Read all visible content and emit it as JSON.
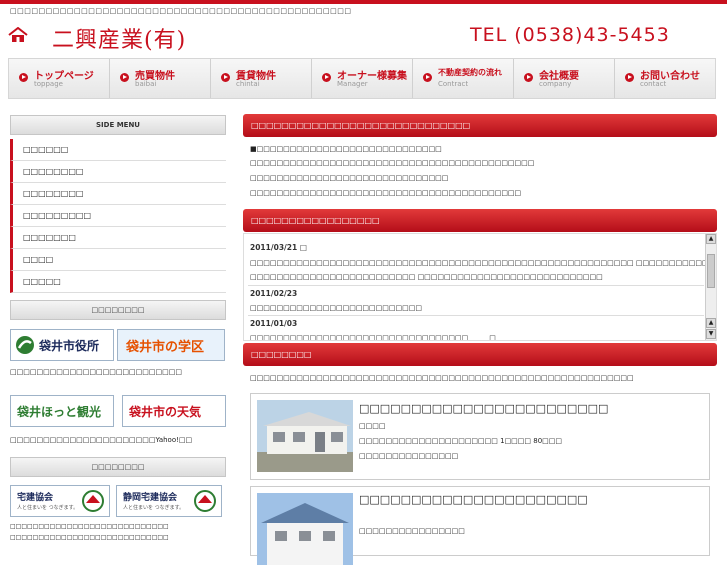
{
  "header": {
    "tagline": "□□□□□□□□□□□□□□□□□□□□□□□□□□□□□□□□□□□□□□□□□□□□□□□□",
    "company_name": "二興産業(有)",
    "tel": "TEL (0538)43-5453"
  },
  "nav": {
    "items": [
      {
        "label": "トップページ",
        "sub": "toppage"
      },
      {
        "label": "売買物件",
        "sub": "baibai"
      },
      {
        "label": "賃貸物件",
        "sub": "chintai"
      },
      {
        "label": "オーナー様募集",
        "sub": "Manager"
      },
      {
        "label": "不動産契約の流れ",
        "sub": "Contract"
      },
      {
        "label": "会社概要",
        "sub": "company"
      },
      {
        "label": "お問い合わせ",
        "sub": "contact"
      }
    ]
  },
  "sidebar": {
    "menu_title": "SIDE MENU",
    "items": [
      {
        "label": "□□□□□□"
      },
      {
        "label": "□□□□□□□□"
      },
      {
        "label": "□□□□□□□□"
      },
      {
        "label": "□□□□□□□□□"
      },
      {
        "label": "□□□□□□□"
      },
      {
        "label": "□□□□"
      },
      {
        "label": "□□□□□"
      }
    ],
    "links_title": "□□□□□□□□",
    "banner1_text": "袋井市役所",
    "banner2_text": "袋井市の学区",
    "links_desc1": "□□□□□□□□□□□□□□□□□□□□□□□□□□",
    "banner3_text": "袋井ほっと観光",
    "banner4_text": "袋井市の天気",
    "links_desc2": "□□□□□□□□□□□□□□□□□□□□□□Yahoo!□□",
    "assoc_title": "□□□□□□□□",
    "banner5_text": "宅建協会",
    "banner5_sub": "人と住まいを つなぎます。",
    "banner6_text": "静岡宅建協会",
    "banner6_sub": "人と住まいを つなぎます。",
    "assoc_desc1": "□□□□□□□□□□□□□□□□□□□□□□□□□□□□",
    "assoc_desc2": "□□□□□□□□□□□□□□□□□□□□□□□□□□□□"
  },
  "main": {
    "intro_heading": "□□□□□□□□□□□□□□□□□□□□□□□□□□□□□",
    "intro_lines": [
      "■□□□□□□□□□□□□□□□□□□□□□□□□□□□□",
      "□□□□□□□□□□□□□□□□□□□□□□□□□□□□□□□□□□□□□□□□□□□",
      "□□□□□□□□□□□□□□□□□□□□□□□□□□□□□□",
      "□□□□□□□□□□□□□□□□□□□□□□□□□□□□□□□□□□□□□□□□□"
    ],
    "news_heading": "□□□□□□□□□□□□□□□□□",
    "news": [
      {
        "date": "2011/03/21 □",
        "lines": [
          "□□□□□□□□□□□□□□□□□□□□□□□□□□□□□□□□□□□□□□□□□□□□□□□□□□□□□□□□□□ □□□□□□□□□□□□□□□□□□□□□□□□□□□□",
          "□□□□□□□□□□□□□□□□□□□□□□□□□ □□□□□□□□□□□□□□□□□□□□□□□□□□□□"
        ]
      },
      {
        "date": "2011/02/23",
        "lines": [
          "□□□□□□□□□□□□□□□□□□□□□□□□□□"
        ]
      },
      {
        "date": "2011/01/03",
        "lines": [
          "□□□□□□□□□□□□□□□□□□□□□□□□□□□□□□□□□　　　□"
        ]
      }
    ],
    "property_heading": "□□□□□□□□",
    "property_desc": "□□□□□□□□□□□□□□□□□□□□□□□□□□□□□□□□□□□□□□□□□□□□□□□□□□□□□□□□□□",
    "properties": [
      {
        "title": "□□□□□□□□□□□□□□□□□□□□□□□□",
        "line1": "□□□□",
        "line2": "□□□□□□□□□□□□□□□□□□□□□ 1□□□□ 80□□□",
        "line3": "□□□□□□□□□□□□□□□"
      },
      {
        "title": "□□□□□□□□□□□□□□□□□□□□□□",
        "line1": "□□□□□□□□□□□□□□□□"
      }
    ]
  },
  "colors": {
    "accent": "#c8101e",
    "header_grad_top": "#e23a3a",
    "header_grad_bottom": "#b40d19"
  }
}
